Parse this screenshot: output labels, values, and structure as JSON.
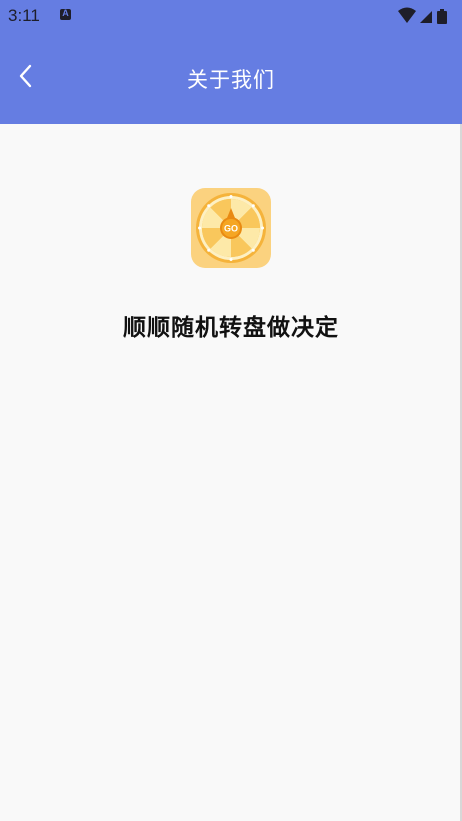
{
  "status_bar": {
    "time": "3:11",
    "notification_icon": "a-notification-icon",
    "icons": [
      "wifi-icon",
      "signal-icon",
      "battery-icon"
    ]
  },
  "app_bar": {
    "title": "关于我们",
    "back_icon": "chevron-left-icon",
    "background_color": "#657de2"
  },
  "content": {
    "logo_icon": "prize-wheel-icon",
    "logo_text": "GO",
    "app_name": "顺顺随机转盘做决定"
  }
}
